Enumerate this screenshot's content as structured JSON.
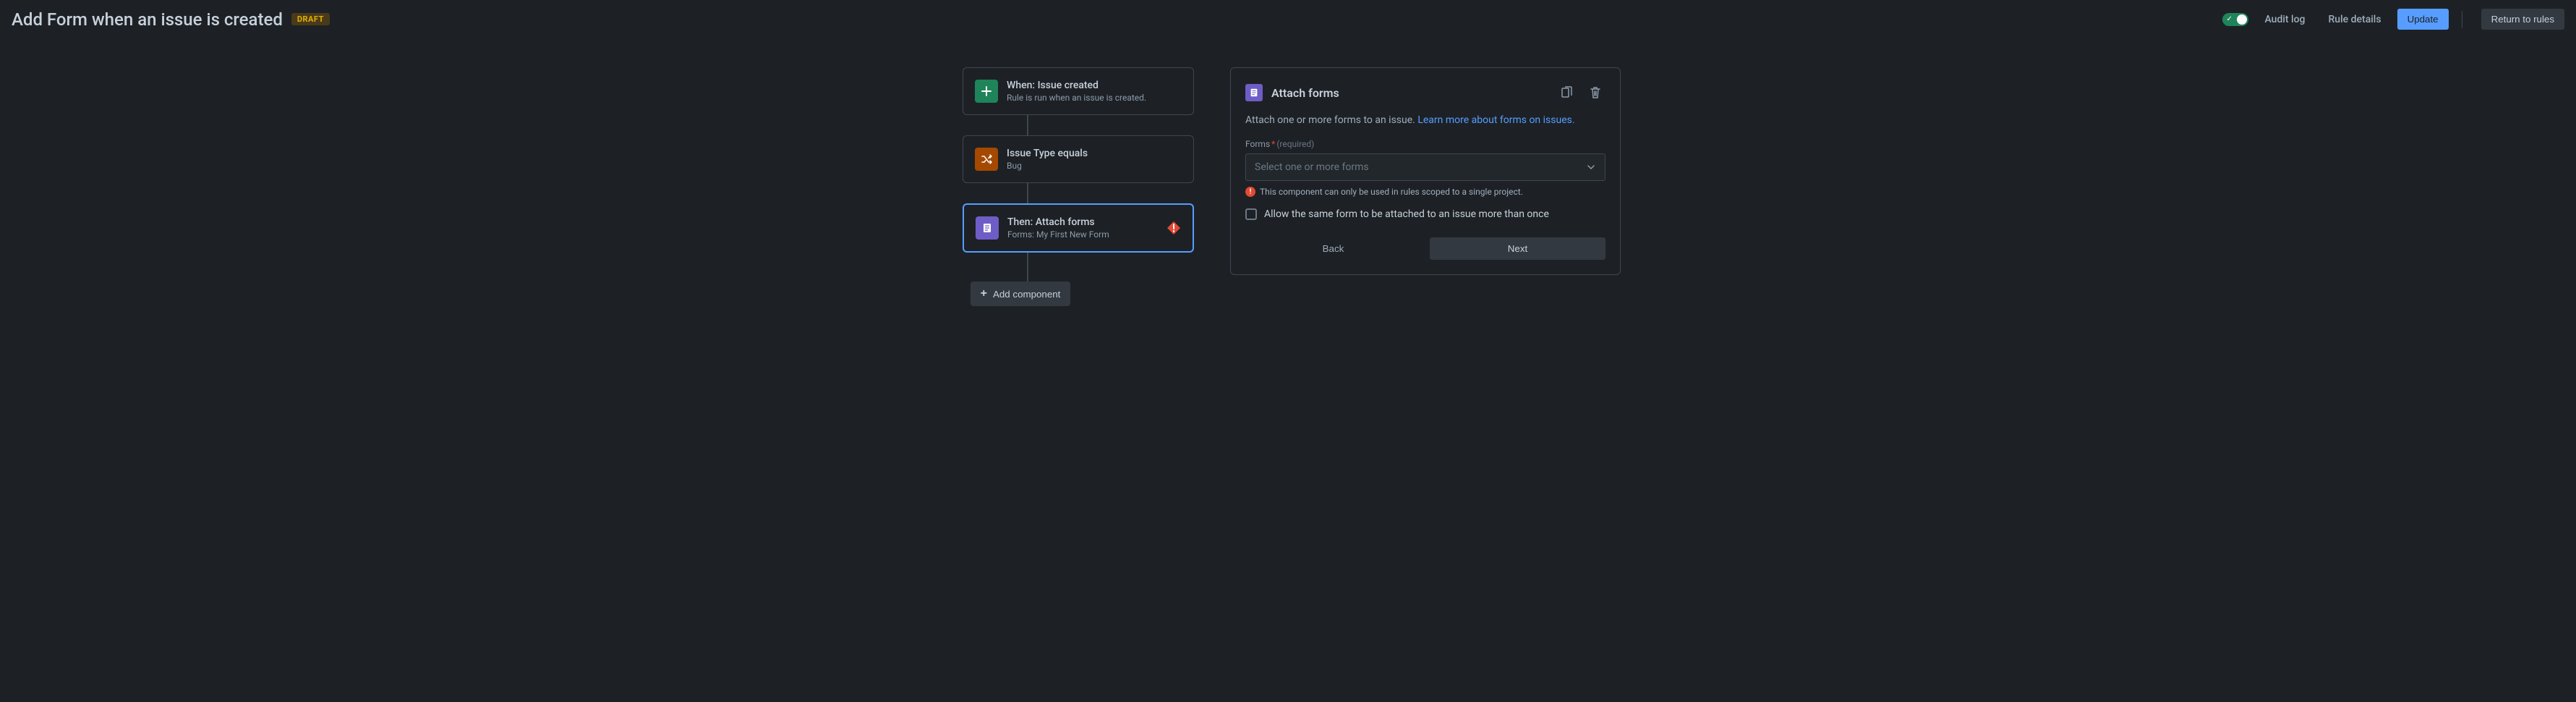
{
  "header": {
    "title": "Add Form when an issue is created",
    "badge": "DRAFT",
    "audit_log": "Audit log",
    "rule_details": "Rule details",
    "update": "Update",
    "return": "Return to rules"
  },
  "flow": {
    "when": {
      "title": "When: Issue created",
      "subtitle": "Rule is run when an issue is created."
    },
    "condition": {
      "title": "Issue Type equals",
      "subtitle": "Bug"
    },
    "then": {
      "title": "Then: Attach forms",
      "subtitle": "Forms: My First New Form"
    },
    "add_component": "Add component"
  },
  "panel": {
    "title": "Attach forms",
    "desc_prefix": "Attach one or more forms to an issue. ",
    "desc_link": "Learn more about forms on issues.",
    "forms_label": "Forms",
    "required_hint": "(required)",
    "select_placeholder": "Select one or more forms",
    "error_msg": "This component can only be used in rules scoped to a single project.",
    "checkbox_label": "Allow the same form to be attached to an issue more than once",
    "back": "Back",
    "next": "Next"
  }
}
